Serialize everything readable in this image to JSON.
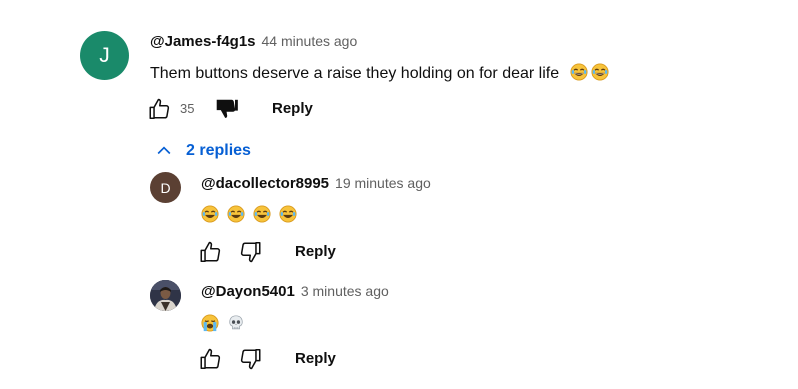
{
  "comment": {
    "avatar_letter": "J",
    "avatar_color": "#1a8a6a",
    "handle": "@James-f4g1s",
    "time": "44 minutes ago",
    "text": "Them buttons deserve a raise they holding on for dear life",
    "emojis": [
      "joy",
      "joy"
    ],
    "like_count": "35",
    "reply_label": "Reply",
    "disliked": true
  },
  "replies_toggle": {
    "label": "2 replies",
    "color": "#065fd4"
  },
  "replies": [
    {
      "avatar_letter": "D",
      "avatar_color": "#5b4033",
      "handle": "@dacollector8995",
      "time": "19 minutes ago",
      "emojis": [
        "joy",
        "joy",
        "joy",
        "joy"
      ],
      "reply_label": "Reply"
    },
    {
      "avatar_type": "photo",
      "handle": "@Dayon5401",
      "time": "3 minutes ago",
      "emojis": [
        "loudly-crying",
        "skull"
      ],
      "reply_label": "Reply"
    }
  ]
}
